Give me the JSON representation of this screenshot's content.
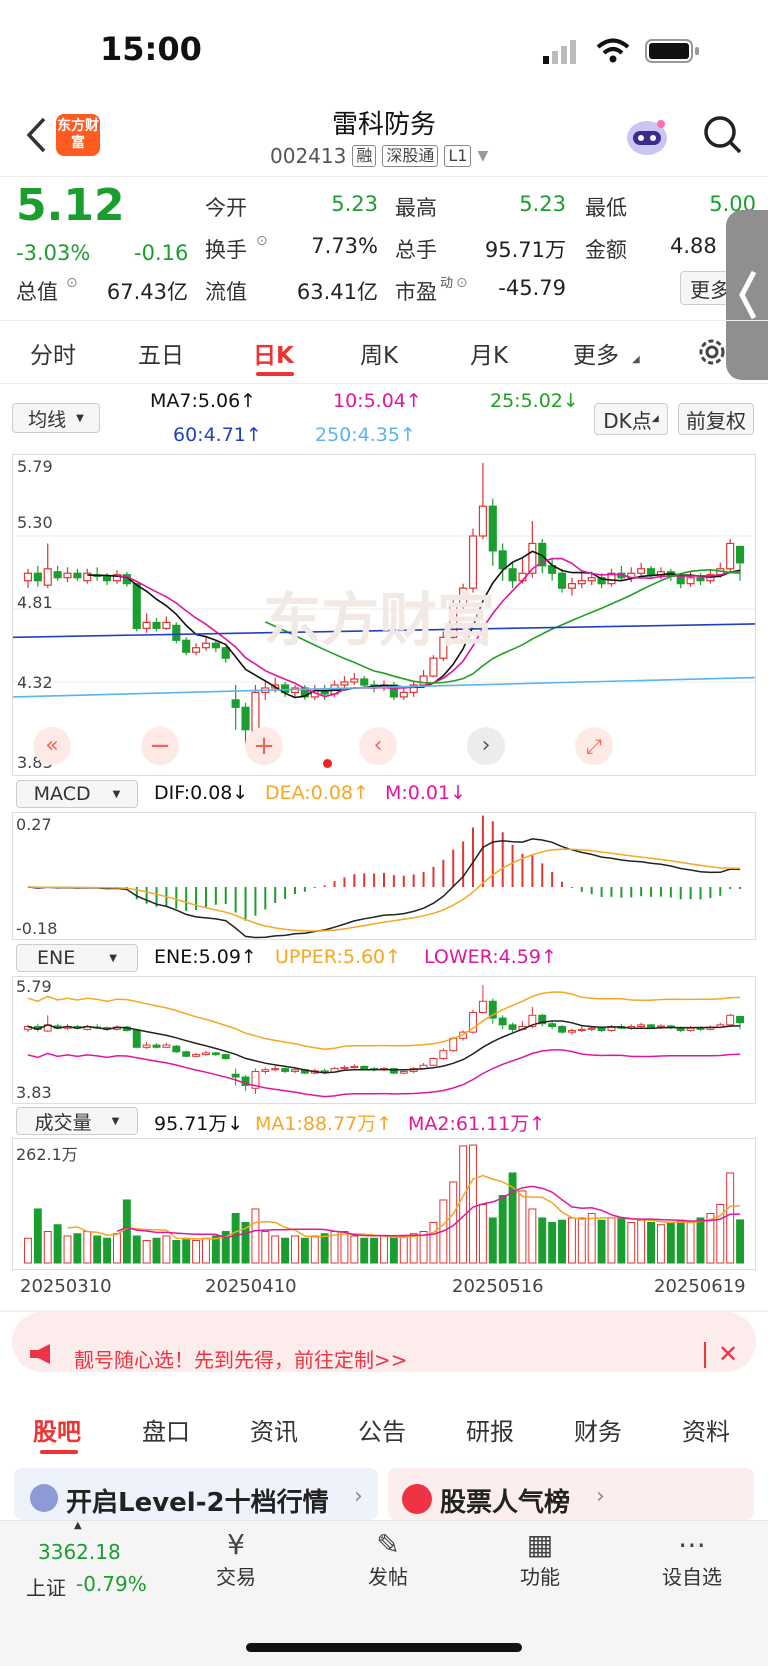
{
  "status": {
    "time": "15:00"
  },
  "header": {
    "logo_text": "东方财富",
    "stock_name": "雷科防务",
    "code": "002413",
    "tags": [
      "融",
      "深股通",
      "L1"
    ]
  },
  "quote": {
    "price": "5.12",
    "change_pct": "-3.03%",
    "change": "-0.16",
    "rows": [
      [
        {
          "label": "今开",
          "value": "5.23"
        },
        {
          "label": "最高",
          "value": "5.23"
        },
        {
          "label": "最低",
          "value": "5.00"
        }
      ],
      [
        {
          "label": "换手",
          "value": "7.73%"
        },
        {
          "label": "总手",
          "value": "95.71万"
        },
        {
          "label": "金额",
          "value": "4.88"
        }
      ],
      [
        {
          "label": "总值",
          "value": "67.43亿"
        },
        {
          "label": "流值",
          "value": "63.41亿"
        },
        {
          "label": "市盈",
          "value": "-45.79"
        }
      ]
    ],
    "more_label": "更多",
    "pe_superscript": "动"
  },
  "tabs": [
    "分时",
    "五日",
    "日K",
    "周K",
    "月K",
    "更多"
  ],
  "active_tab": "日K",
  "ma_bar": {
    "select": "均线",
    "ma7": "MA7:5.06↑",
    "ma10": "10:5.04↑",
    "ma25": "25:5.02↓",
    "ma60": "60:4.71↑",
    "ma250": "250:4.35↑",
    "dk_button": "DK点",
    "adjust_button": "前复权"
  },
  "kline": {
    "ymax_label": "5.79",
    "y2_label": "5.30",
    "y3_label": "4.81",
    "y4_label": "4.32",
    "ymin_label": "3.83",
    "watermark": "东方财富"
  },
  "macd": {
    "select": "MACD",
    "dif": "DIF:0.08↓",
    "dea": "DEA:0.08↑",
    "m": "M:0.01↓",
    "ymax_label": "0.27",
    "ymin_label": "-0.18"
  },
  "ene": {
    "select": "ENE",
    "ene": "ENE:5.09↑",
    "upper": "UPPER:5.60↑",
    "lower": "LOWER:4.59↑",
    "ymax_label": "5.79",
    "ymin_label": "3.83"
  },
  "volume": {
    "select": "成交量",
    "vol": "95.71万↓",
    "ma1": "MA1:88.77万↑",
    "ma2": "MA2:61.11万↑",
    "ymax_label": "262.1万",
    "dates": [
      "20250310",
      "20250410",
      "20250516",
      "20250619"
    ]
  },
  "banner": {
    "text": "靓号随心选！先到先得，前往定制>>"
  },
  "bottom_tabs": [
    "股吧",
    "盘口",
    "资讯",
    "公告",
    "研报",
    "财务",
    "资料"
  ],
  "active_bottom_tab": "股吧",
  "promo": {
    "left": "开启Level-2十档行情",
    "right": "股票人气榜"
  },
  "bottom_nav": {
    "index_value": "3362.18",
    "index_name": "上证",
    "index_change": "-0.79%",
    "items": [
      "交易",
      "发帖",
      "功能",
      "设自选"
    ]
  },
  "colors": {
    "up": "#e33333",
    "down": "#1a9e2f",
    "ma7": "#111111",
    "ma10": "#e0179e",
    "ma25": "#20a020",
    "ma60": "#2040c0",
    "ma250": "#5ab4f0",
    "dea": "#f5a623"
  },
  "chart_data": {
    "type": "candlestick",
    "x_range": [
      "20250310",
      "20250619"
    ],
    "ylim": [
      3.83,
      5.79
    ],
    "candles": [
      [
        5.0,
        5.05,
        5.08,
        4.95
      ],
      [
        5.05,
        5.0,
        5.1,
        4.96
      ],
      [
        4.97,
        5.08,
        5.25,
        4.95
      ],
      [
        5.06,
        5.02,
        5.1,
        5.0
      ],
      [
        5.02,
        5.05,
        5.09,
        4.99
      ],
      [
        5.05,
        5.02,
        5.08,
        5.0
      ],
      [
        5.0,
        5.05,
        5.08,
        4.98
      ],
      [
        5.04,
        5.03,
        5.09,
        5.0
      ],
      [
        5.03,
        5.0,
        5.05,
        4.97
      ],
      [
        5.0,
        5.04,
        5.07,
        4.98
      ],
      [
        5.04,
        4.98,
        5.06,
        4.96
      ],
      [
        4.98,
        4.68,
        4.98,
        4.66
      ],
      [
        4.68,
        4.72,
        4.78,
        4.65
      ],
      [
        4.72,
        4.68,
        4.75,
        4.66
      ],
      [
        4.68,
        4.72,
        4.76,
        4.67
      ],
      [
        4.7,
        4.6,
        4.72,
        4.58
      ],
      [
        4.6,
        4.52,
        4.62,
        4.5
      ],
      [
        4.52,
        4.55,
        4.58,
        4.5
      ],
      [
        4.55,
        4.58,
        4.62,
        4.53
      ],
      [
        4.58,
        4.55,
        4.6,
        4.52
      ],
      [
        4.55,
        4.48,
        4.56,
        4.45
      ],
      [
        4.2,
        4.15,
        4.3,
        4.0
      ],
      [
        4.15,
        4.0,
        4.18,
        3.9
      ],
      [
        3.95,
        4.25,
        4.3,
        3.85
      ],
      [
        4.25,
        4.28,
        4.32,
        4.2
      ],
      [
        4.28,
        4.3,
        4.35,
        4.25
      ],
      [
        4.3,
        4.25,
        4.32,
        4.22
      ],
      [
        4.25,
        4.28,
        4.3,
        4.22
      ],
      [
        4.28,
        4.22,
        4.3,
        4.2
      ],
      [
        4.22,
        4.26,
        4.3,
        4.2
      ],
      [
        4.26,
        4.24,
        4.3,
        4.2
      ],
      [
        4.24,
        4.3,
        4.33,
        4.22
      ],
      [
        4.3,
        4.32,
        4.36,
        4.27
      ],
      [
        4.32,
        4.34,
        4.38,
        4.3
      ],
      [
        4.34,
        4.3,
        4.36,
        4.28
      ],
      [
        4.3,
        4.28,
        4.33,
        4.25
      ],
      [
        4.28,
        4.3,
        4.33,
        4.26
      ],
      [
        4.3,
        4.22,
        4.32,
        4.2
      ],
      [
        4.22,
        4.25,
        4.28,
        4.2
      ],
      [
        4.25,
        4.3,
        4.33,
        4.22
      ],
      [
        4.3,
        4.36,
        4.4,
        4.28
      ],
      [
        4.36,
        4.48,
        4.5,
        4.35
      ],
      [
        4.48,
        4.62,
        4.66,
        4.46
      ],
      [
        4.62,
        4.84,
        4.87,
        4.6
      ],
      [
        4.84,
        4.95,
        4.98,
        4.8
      ],
      [
        4.95,
        5.3,
        5.35,
        4.92
      ],
      [
        5.3,
        5.5,
        5.79,
        5.28
      ],
      [
        5.5,
        5.2,
        5.55,
        5.1
      ],
      [
        5.2,
        5.08,
        5.25,
        5.0
      ],
      [
        5.08,
        5.0,
        5.12,
        4.95
      ],
      [
        5.0,
        5.05,
        5.15,
        4.98
      ],
      [
        5.05,
        5.25,
        5.4,
        5.02
      ],
      [
        5.25,
        5.1,
        5.28,
        5.05
      ],
      [
        5.1,
        5.05,
        5.15,
        5.0
      ],
      [
        5.05,
        4.95,
        5.08,
        4.92
      ],
      [
        4.95,
        4.98,
        5.02,
        4.9
      ],
      [
        4.98,
        5.0,
        5.05,
        4.95
      ],
      [
        5.0,
        5.02,
        5.06,
        4.97
      ],
      [
        5.02,
        4.98,
        5.05,
        4.95
      ],
      [
        4.98,
        5.05,
        5.08,
        4.96
      ],
      [
        5.05,
        5.02,
        5.1,
        5.0
      ],
      [
        5.02,
        5.05,
        5.09,
        4.99
      ],
      [
        5.05,
        5.08,
        5.12,
        5.02
      ],
      [
        5.08,
        5.04,
        5.1,
        5.01
      ],
      [
        5.04,
        5.06,
        5.09,
        5.01
      ],
      [
        5.06,
        5.03,
        5.08,
        5.0
      ],
      [
        5.03,
        4.98,
        5.05,
        4.95
      ],
      [
        4.98,
        5.02,
        5.06,
        4.96
      ],
      [
        5.02,
        5.0,
        5.05,
        4.97
      ],
      [
        5.0,
        5.04,
        5.07,
        4.98
      ],
      [
        5.04,
        5.08,
        5.12,
        5.02
      ],
      [
        5.08,
        5.25,
        5.28,
        5.05
      ],
      [
        5.23,
        5.12,
        5.23,
        5.0
      ]
    ],
    "volumes": [
      55,
      120,
      70,
      85,
      60,
      65,
      70,
      60,
      55,
      65,
      140,
      60,
      50,
      55,
      60,
      50,
      55,
      50,
      55,
      60,
      70,
      110,
      90,
      120,
      70,
      60,
      55,
      60,
      55,
      60,
      65,
      70,
      70,
      60,
      55,
      55,
      60,
      55,
      60,
      65,
      70,
      90,
      140,
      180,
      260,
      262,
      130,
      100,
      150,
      200,
      160,
      120,
      100,
      90,
      95,
      100,
      100,
      110,
      95,
      100,
      100,
      90,
      95,
      90,
      85,
      90,
      95,
      90,
      100,
      110,
      130,
      200,
      95.71
    ]
  }
}
